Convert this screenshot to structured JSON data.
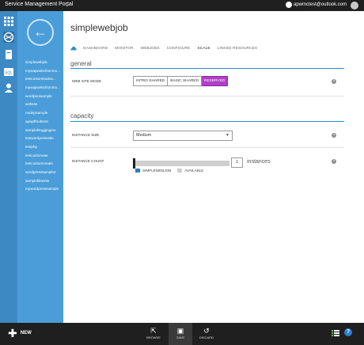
{
  "topbar": {
    "portal_title": "Service Management Portal",
    "dropdown_chevron": "⌄",
    "user_email": "apwmctest@outlook.com"
  },
  "rail": {
    "icons": [
      "grid-icon",
      "web-icon",
      "database-icon",
      "sql-icon",
      "user-icon"
    ]
  },
  "nav": {
    "back_glyph": "←",
    "sites": [
      "simplewebjob",
      "mywapwebclitonmo...",
      "testcustomtrailna...",
      "mywapwebclitonmo...",
      "wordpressample",
      "websss",
      "nodejssample",
      "apwpfthubtest",
      "samplebloggingme",
      "testwordpresssite",
      "testphp",
      "testcustcreate",
      "testcustomcreate",
      "wordpresssample2",
      "samplefilewrite",
      "mywordpresssample"
    ]
  },
  "main": {
    "site_name": "simplewebjob",
    "tabs": [
      "DASHBOARD",
      "MONITOR",
      "WEBJOBS",
      "CONFIGURE",
      "SCALE",
      "LINKED RESOURCES"
    ],
    "active_tab": "SCALE",
    "general": {
      "heading": "general",
      "web_site_mode_label": "WEB SITE MODE",
      "modes": [
        "INTRO SHARED",
        "BASIC SHARED",
        "RESERVED"
      ],
      "selected_mode": "RESERVED"
    },
    "capacity": {
      "heading": "capacity",
      "instance_size_label": "INSTANCE SIZE",
      "instance_size_value": "Medium",
      "instance_count_label": "INSTANCE COUNT",
      "instance_count_value": "1",
      "instances_unit": "instances",
      "legend": [
        "SIMPLEWEBJOB",
        "AVAILABLE"
      ]
    },
    "help_glyph": "?"
  },
  "bottombar": {
    "new_label": "NEW",
    "browse_label": "BROWSE",
    "save_label": "SAVE",
    "discard_label": "DISCARD",
    "help_glyph": "?"
  },
  "colors": {
    "accent_blue": "#2f8cd2",
    "rail_blue": "#3c89c3",
    "nav_blue": "#4a9dd8",
    "reserved_purple": "#b23ec8",
    "legend_used": "#2a7fc4",
    "legend_available": "#cfcfcf"
  }
}
